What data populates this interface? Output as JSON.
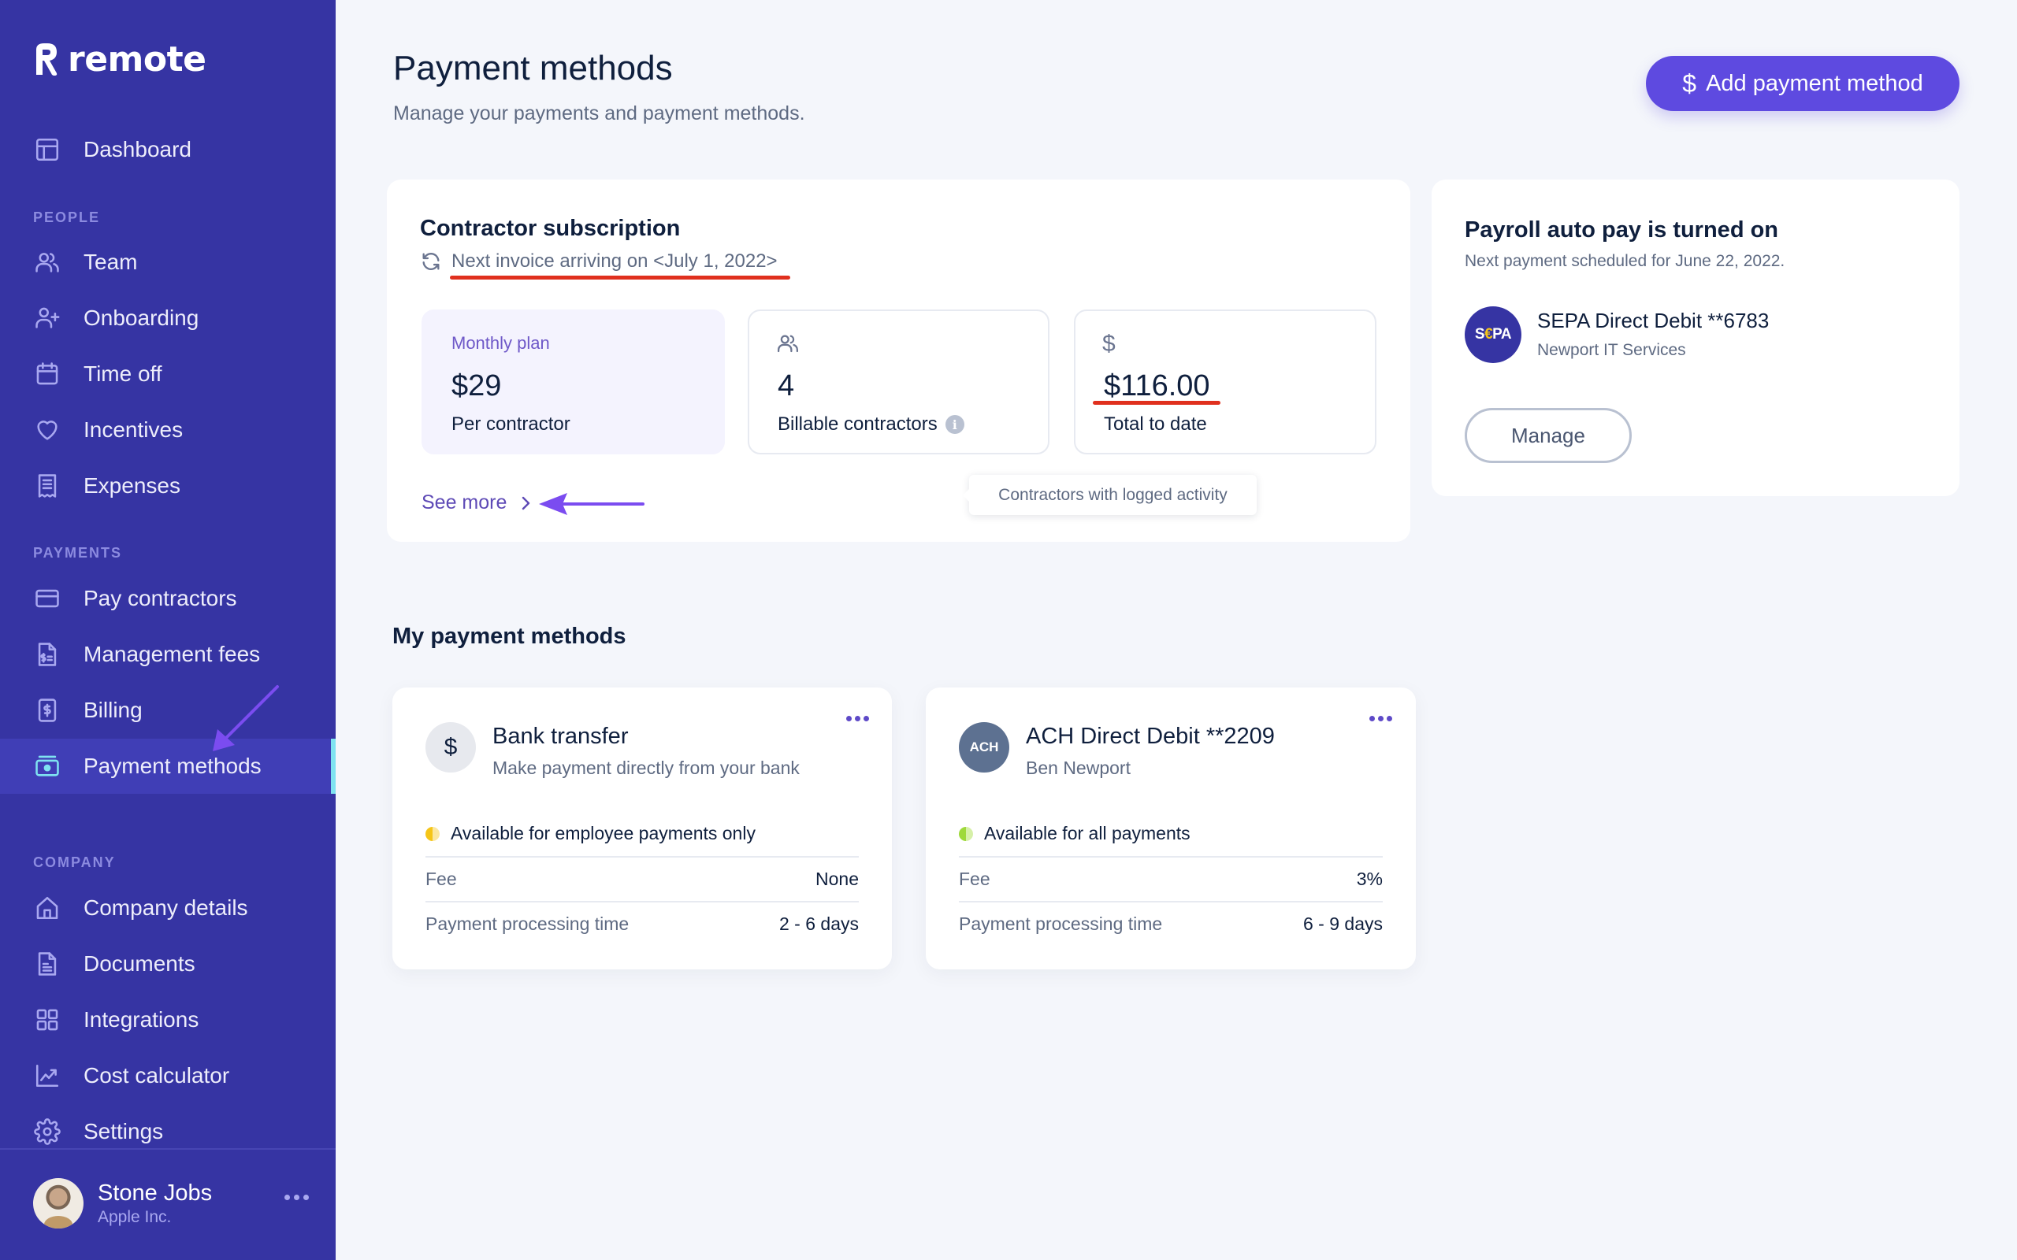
{
  "brand": {
    "name": "remote",
    "colors": {
      "sidebar": "#3634A3",
      "accent": "#5E4AE0",
      "active_indicator": "#7FE3F1",
      "annotation_red": "#E0301E",
      "annotation_purple": "#7B4CF0"
    }
  },
  "sidebar": {
    "top_items": [
      {
        "label": "Dashboard",
        "icon": "dashboard-icon"
      }
    ],
    "sections": [
      {
        "title": "PEOPLE",
        "items": [
          {
            "label": "Team",
            "icon": "team-icon"
          },
          {
            "label": "Onboarding",
            "icon": "user-plus-icon"
          },
          {
            "label": "Time off",
            "icon": "calendar-icon"
          },
          {
            "label": "Incentives",
            "icon": "heart-icon"
          },
          {
            "label": "Expenses",
            "icon": "receipt-icon"
          }
        ]
      },
      {
        "title": "PAYMENTS",
        "items": [
          {
            "label": "Pay contractors",
            "icon": "credit-card-icon"
          },
          {
            "label": "Management fees",
            "icon": "fee-document-icon"
          },
          {
            "label": "Billing",
            "icon": "billing-icon"
          },
          {
            "label": "Payment methods",
            "icon": "wallet-icon",
            "active": true
          }
        ]
      },
      {
        "title": "COMPANY",
        "items": [
          {
            "label": "Company details",
            "icon": "home-icon"
          },
          {
            "label": "Documents",
            "icon": "document-icon"
          },
          {
            "label": "Integrations",
            "icon": "grid-icon"
          },
          {
            "label": "Cost calculator",
            "icon": "chart-icon"
          },
          {
            "label": "Settings",
            "icon": "gear-icon"
          }
        ]
      }
    ],
    "user": {
      "name": "Stone Jobs",
      "company": "Apple Inc."
    }
  },
  "header": {
    "title": "Payment methods",
    "subtitle": "Manage your payments and payment methods.",
    "add_button": {
      "icon": "$",
      "label": "Add payment method"
    }
  },
  "subscription": {
    "title": "Contractor subscription",
    "next_invoice": "Next invoice arriving on <July 1, 2022>",
    "stats": [
      {
        "label": "Monthly plan",
        "value": "$29",
        "caption": "Per contractor"
      },
      {
        "icon": "users-icon",
        "value": "4",
        "caption": "Billable contractors",
        "info": "i"
      },
      {
        "icon": "$",
        "value": "$116.00",
        "caption": "Total to date"
      }
    ],
    "see_more": "See more",
    "tooltip": "Contractors with logged activity"
  },
  "autopay": {
    "title": "Payroll auto pay is turned on",
    "subtitle": "Next payment scheduled for June 22, 2022.",
    "logo": {
      "left": "S",
      "euro": "€",
      "right": "PA"
    },
    "method": "SEPA Direct Debit **6783",
    "owner": "Newport IT Services",
    "manage_label": "Manage"
  },
  "my_methods": {
    "title": "My payment methods",
    "cards": [
      {
        "logo": "$",
        "name": "Bank transfer",
        "description": "Make payment directly from your bank",
        "status": "Available for employee payments only",
        "status_color": "#F5C518",
        "rows": [
          {
            "key": "Fee",
            "value": "None"
          },
          {
            "key": "Payment processing time",
            "value": "2 - 6 days"
          }
        ]
      },
      {
        "logo": "ACH",
        "name": "ACH Direct Debit **2209",
        "description": "Ben Newport",
        "status": "Available for all payments",
        "status_color": "#9ED93A",
        "rows": [
          {
            "key": "Fee",
            "value": "3%"
          },
          {
            "key": "Payment processing time",
            "value": "6 - 9 days"
          }
        ]
      }
    ]
  }
}
